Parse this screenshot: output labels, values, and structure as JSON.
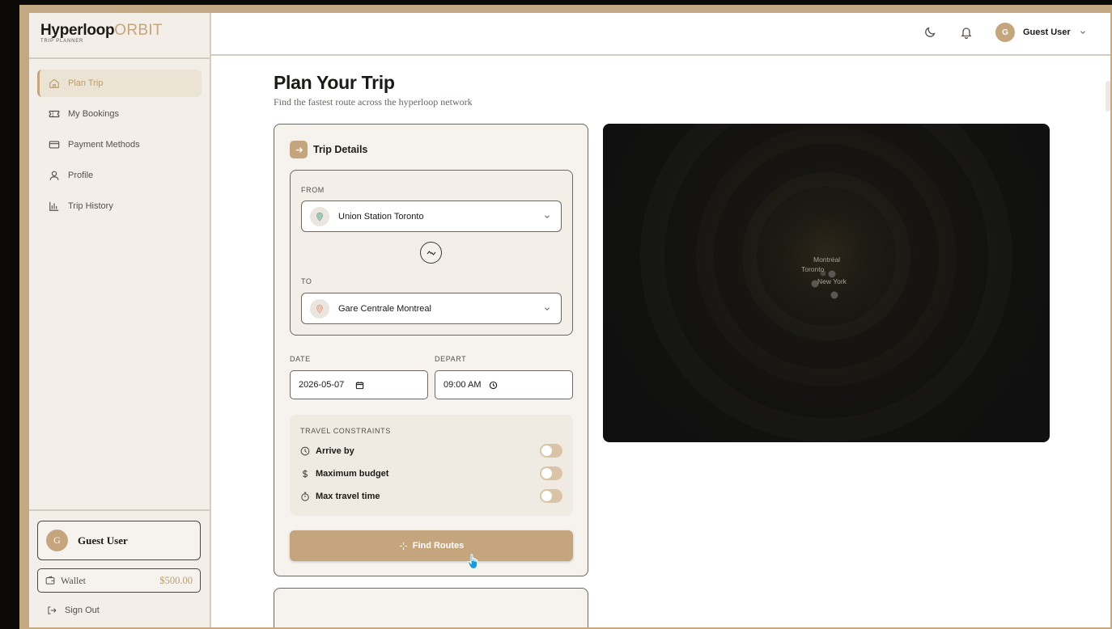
{
  "brand": {
    "name": "Hyperloop",
    "accent": "ORBIT",
    "subtitle": "TRIP PLANNER"
  },
  "sidebar": {
    "items": [
      {
        "label": "Plan Trip",
        "icon": "home-icon",
        "active": true
      },
      {
        "label": "My Bookings",
        "icon": "ticket-icon"
      },
      {
        "label": "Payment Methods",
        "icon": "credit-card-icon"
      },
      {
        "label": "Profile",
        "icon": "user-icon"
      },
      {
        "label": "Trip History",
        "icon": "bar-chart-icon"
      }
    ],
    "user": {
      "initial": "G",
      "name": "Guest User"
    },
    "wallet": {
      "label": "Wallet",
      "amount": "$500.00",
      "icon": "wallet-icon"
    },
    "signout": {
      "label": "Sign Out",
      "icon": "log-out-icon"
    }
  },
  "topbar": {
    "icons": [
      "moon-icon",
      "bell-icon"
    ],
    "user": {
      "initial": "G",
      "name": "Guest User"
    }
  },
  "main": {
    "title": "Plan Your Trip",
    "subtitle": "Find the fastest route across the hyperloop network"
  },
  "trip": {
    "header": "Trip Details",
    "from": {
      "label": "FROM",
      "value": "Union Station Toronto"
    },
    "to": {
      "label": "TO",
      "value": "Gare Centrale Montreal"
    },
    "date": {
      "label": "DATE",
      "value": "2026-05-07"
    },
    "depart": {
      "label": "DEPART",
      "value": "09:00 AM"
    },
    "constraints": {
      "label": "TRAVEL CONSTRAINTS",
      "items": [
        {
          "label": "Arrive by",
          "icon": "clock-icon",
          "enabled": false
        },
        {
          "label": "Maximum budget",
          "icon": "dollar-icon",
          "enabled": false
        },
        {
          "label": "Max travel time",
          "icon": "stopwatch-icon",
          "enabled": false
        }
      ]
    },
    "find_button": "Find Routes"
  },
  "map": {
    "cities": [
      "Montréal",
      "Toronto",
      "New York"
    ]
  },
  "colors": {
    "accent": "#c4a57e",
    "sidebar_bg": "#f3efe8",
    "frame": "#c4a984",
    "map_bg": "#111110"
  }
}
